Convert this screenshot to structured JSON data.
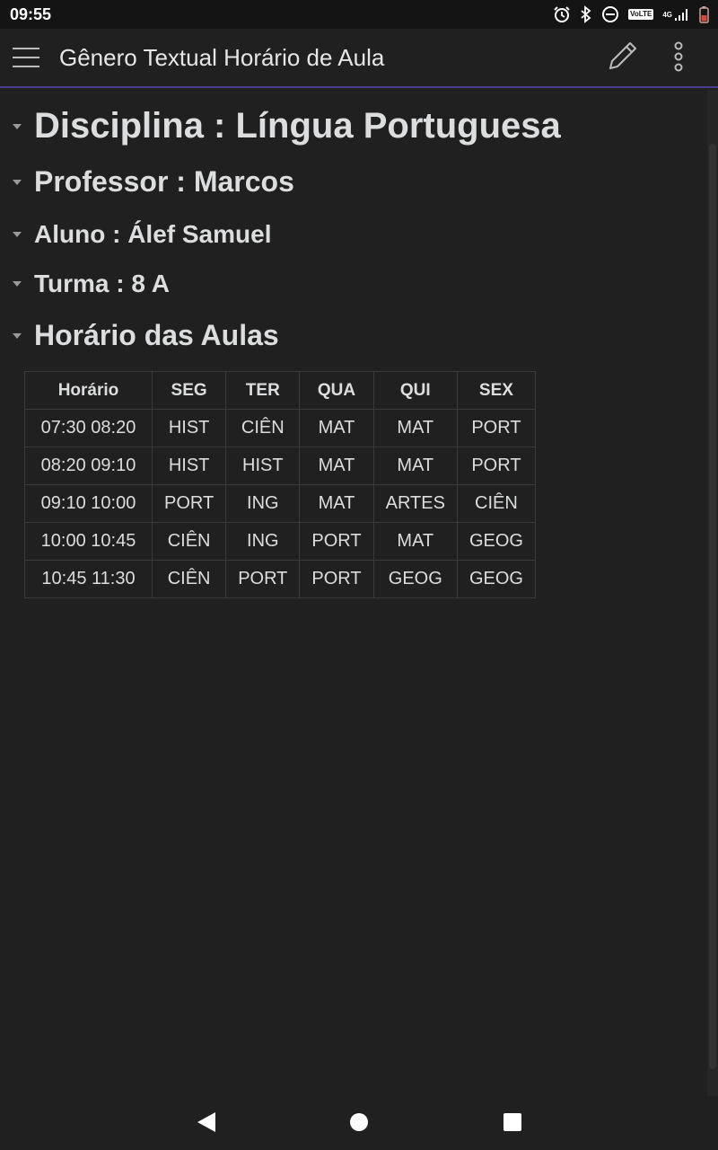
{
  "status_bar": {
    "time": "09:55",
    "icons": [
      "alarm-icon",
      "bluetooth-icon",
      "dnd-icon",
      "volte-icon",
      "signal-icon",
      "battery-icon"
    ],
    "volte_label": "VoLTE",
    "network_label": "4G"
  },
  "app_bar": {
    "title": "Gênero Textual Horário de Aula",
    "icons": [
      "hamburger-menu-icon",
      "pencil-edit-icon",
      "more-vertical-icon"
    ]
  },
  "note": {
    "heading_discipline": "Disciplina : Língua Portuguesa",
    "heading_teacher": "Professor : Marcos",
    "heading_student": "Aluno : Álef Samuel",
    "heading_class": "Turma : 8 A",
    "heading_schedule": "Horário das Aulas"
  },
  "schedule": {
    "headers": [
      "Horário",
      "SEG",
      "TER",
      "QUA",
      "QUI",
      "SEX"
    ],
    "rows": [
      [
        "07:30 08:20",
        "HIST",
        "CIÊN",
        "MAT",
        "MAT",
        "PORT"
      ],
      [
        "08:20 09:10",
        "HIST",
        "HIST",
        "MAT",
        "MAT",
        "PORT"
      ],
      [
        "09:10 10:00",
        "PORT",
        "ING",
        "MAT",
        "ARTES",
        "CIÊN"
      ],
      [
        "10:00 10:45",
        "CIÊN",
        "ING",
        "PORT",
        "MAT",
        "GEOG"
      ],
      [
        "10:45 11:30",
        "CIÊN",
        "PORT",
        "PORT",
        "GEOG",
        "GEOG"
      ]
    ]
  },
  "nav_bar": {
    "icons": [
      "back-triangle-icon",
      "home-circle-icon",
      "recents-square-icon"
    ]
  },
  "colors": {
    "background": "#202020",
    "status_bar": "#141414",
    "accent_line": "#4a3d8f",
    "text": "#dcddde",
    "table_border": "#3a3a3a"
  }
}
